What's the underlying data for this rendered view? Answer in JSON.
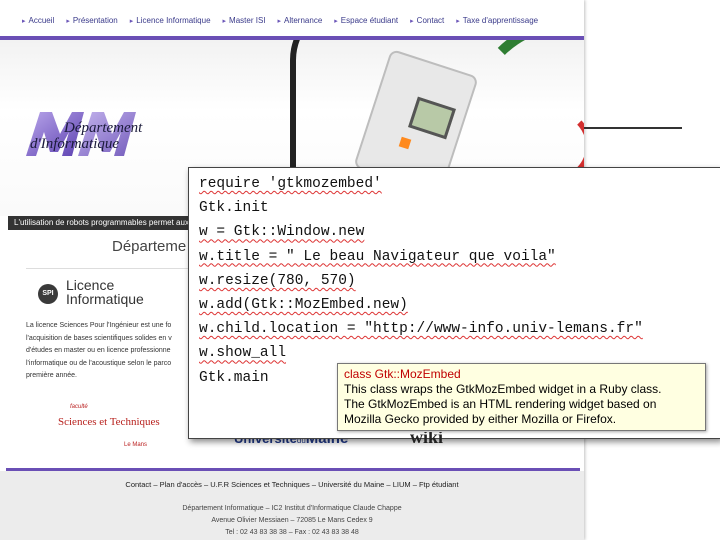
{
  "nav": {
    "items": [
      {
        "label": "Accueil"
      },
      {
        "label": "Présentation"
      },
      {
        "label": "Licence Informatique"
      },
      {
        "label": "Master ISI"
      },
      {
        "label": "Alternance"
      },
      {
        "label": "Espace étudiant"
      },
      {
        "label": "Contact"
      },
      {
        "label": "Taxe d'apprentissage"
      }
    ]
  },
  "banner": {
    "logo_line1": "Département",
    "logo_line2": "d'Informatique",
    "caption": "L'utilisation de robots programmables permet aux"
  },
  "main": {
    "page_title": "Départeme",
    "spi_badge": "SPI",
    "licence_title_line1": "Licence",
    "licence_title_line2": "Informatique",
    "licence_text": [
      "La licence Sciences Pour l'Ingénieur est une fo",
      "l'acquisition de bases scientifiques solides en v",
      "d'études en master ou en licence professionne",
      "l'informatique ou de l'acoustique selon le parco",
      "première année."
    ]
  },
  "partners": {
    "ufr_superscript": "faculté",
    "ufr_name": "Sciences et Techniques",
    "ufr_city": "Le Mans",
    "univ_prefix": "Université",
    "univ_du": "du",
    "univ_name": "Maine",
    "partial_logo": "wiki"
  },
  "footer": {
    "links": "Contact – Plan d'accès – U.F.R Sciences et Techniques – Université du Maine – LIUM – Ftp étudiant",
    "address": [
      "Département Informatique – IC2 Institut d'Informatique Claude Chappe",
      "Avenue Olivier Messiaen – 72085 Le Mans Cedex 9",
      "Tel : 02 43 83 38 38 – Fax : 02 43 83 38 48"
    ]
  },
  "code": {
    "lines": [
      "require 'gtkmozembed'",
      "Gtk.init",
      "w = Gtk::Window.new",
      "w.title = \" Le beau Navigateur que voila\"",
      "w.resize(780, 570)",
      "w.add(Gtk::MozEmbed.new)",
      "w.child.location = \"http://www-info.univ-lemans.fr\"",
      "w.show_all",
      "Gtk.main"
    ]
  },
  "tooltip": {
    "title": "class Gtk::MozEmbed",
    "text": [
      "This class wraps the GtkMozEmbed widget in a Ruby class.",
      "The GtkMozEmbed is an HTML rendering widget based on",
      "Mozilla Gecko provided by either Mozilla or Firefox."
    ]
  },
  "colors": {
    "accent_purple": "#6a4fb5",
    "tooltip_bg": "#ffffe1",
    "tooltip_title": "#c00000",
    "ufr_red": "#b8221e",
    "univ_blue": "#223a8a"
  }
}
